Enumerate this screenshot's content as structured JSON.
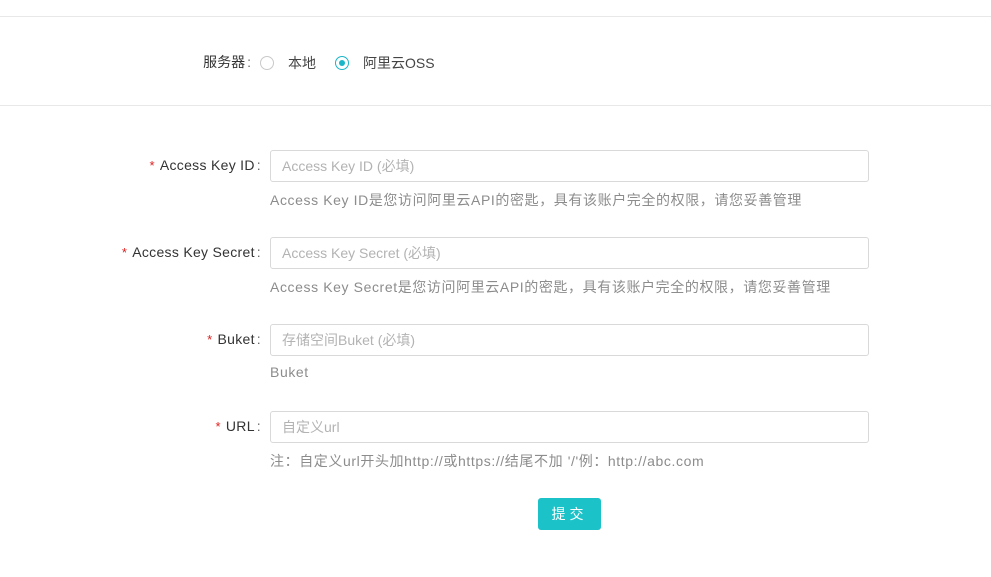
{
  "server": {
    "label": "服务器",
    "options": [
      {
        "label": "本地",
        "selected": false
      },
      {
        "label": "阿里云OSS",
        "selected": true
      }
    ]
  },
  "form": {
    "required_mark": "*",
    "fields": [
      {
        "label": "Access Key ID",
        "placeholder": "Access Key ID (必填)",
        "value": "",
        "help": "Access Key ID是您访问阿里云API的密匙，具有该账户完全的权限，请您妥善管理"
      },
      {
        "label": "Access Key Secret",
        "placeholder": "Access Key Secret (必填)",
        "value": "",
        "help": "Access Key Secret是您访问阿里云API的密匙，具有该账户完全的权限，请您妥善管理"
      },
      {
        "label": "Buket",
        "placeholder": "存储空间Buket (必填)",
        "value": "",
        "help": "Buket"
      },
      {
        "label": "URL",
        "placeholder": "自定义url",
        "value": "",
        "help": "注：自定义url开头加http://或https://结尾不加 '/'例：http://abc.com"
      }
    ],
    "submit_label": "提交"
  },
  "colors": {
    "accent": "#1bc3c9",
    "required": "#e02020",
    "help_text": "#8c8c8c"
  }
}
